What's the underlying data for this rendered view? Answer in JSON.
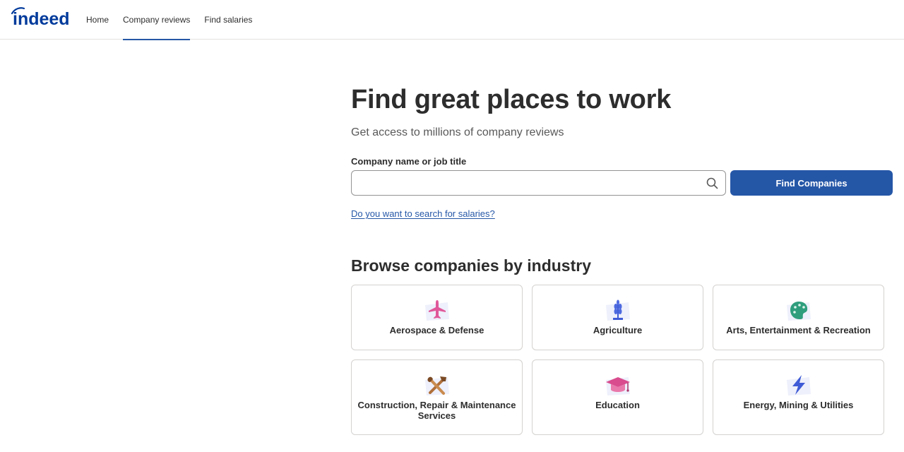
{
  "header": {
    "logo_text": "indeed",
    "nav": [
      {
        "label": "Home",
        "active": false
      },
      {
        "label": "Company reviews",
        "active": true
      },
      {
        "label": "Find salaries",
        "active": false
      }
    ]
  },
  "hero": {
    "title": "Find great places to work",
    "subtitle": "Get access to millions of company reviews"
  },
  "search": {
    "label": "Company name or job title",
    "value": "",
    "placeholder": "",
    "button_label": "Find Companies",
    "salary_link": "Do you want to search for salaries?"
  },
  "browse": {
    "title": "Browse companies by industry",
    "industries": [
      {
        "label": "Aerospace & Defense",
        "icon": "airplane-icon"
      },
      {
        "label": "Agriculture",
        "icon": "wheat-icon"
      },
      {
        "label": "Arts, Entertainment & Recreation",
        "icon": "palette-icon"
      },
      {
        "label": "Construction, Repair & Maintenance Services",
        "icon": "tools-icon"
      },
      {
        "label": "Education",
        "icon": "graduation-cap-icon"
      },
      {
        "label": "Energy, Mining & Utilities",
        "icon": "lightning-icon"
      }
    ]
  },
  "colors": {
    "brand": "#2557a7",
    "logo": "#003a9b",
    "text": "#2d2d2d",
    "border": "#d4d2d0"
  }
}
